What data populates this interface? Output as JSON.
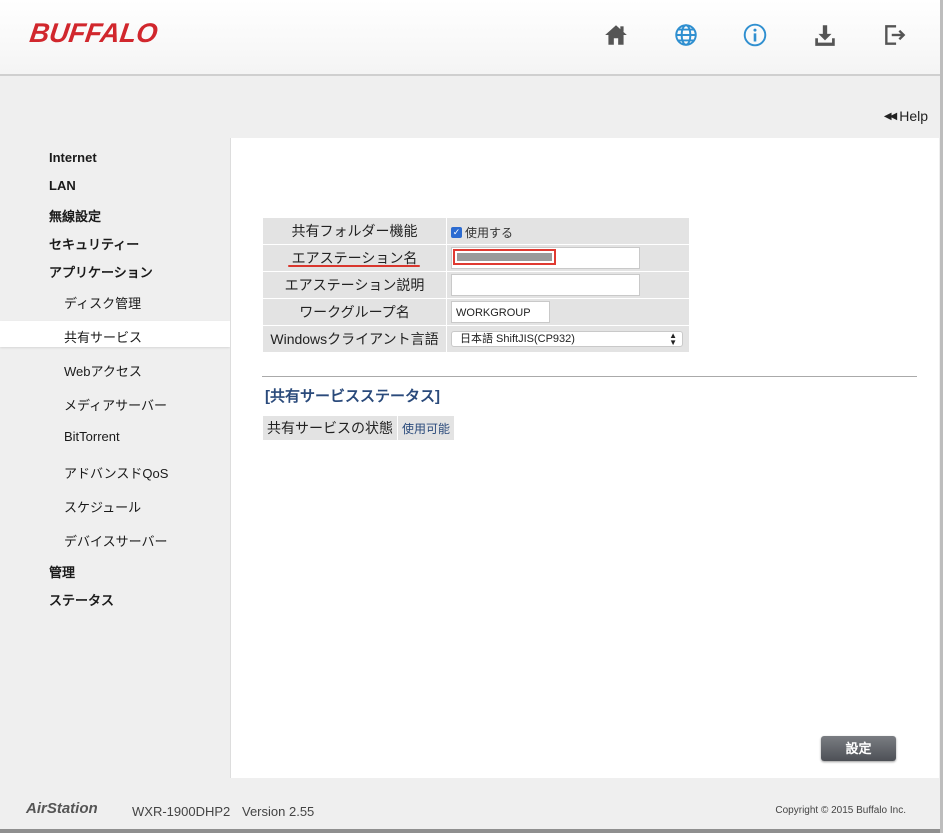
{
  "header": {
    "logo": "BUFFALO",
    "icons": [
      {
        "name": "home-icon",
        "color": "#555555"
      },
      {
        "name": "globe-icon",
        "color": "#2f8fd0"
      },
      {
        "name": "info-icon",
        "color": "#2f8fd0"
      },
      {
        "name": "download-icon",
        "color": "#555555"
      },
      {
        "name": "logout-icon",
        "color": "#555555"
      }
    ]
  },
  "help": {
    "label": "Help",
    "arrow": "◀◀"
  },
  "sidebar": {
    "items": [
      {
        "label": "Internet",
        "level": 1
      },
      {
        "label": "LAN",
        "level": 1
      },
      {
        "label": "無線設定",
        "level": 1
      },
      {
        "label": "セキュリティー",
        "level": 1
      },
      {
        "label": "アプリケーション",
        "level": 1
      },
      {
        "label": "ディスク管理",
        "level": 2
      },
      {
        "label": "共有サービス",
        "level": 2,
        "active": true
      },
      {
        "label": "Webアクセス",
        "level": 2
      },
      {
        "label": "メディアサーバー",
        "level": 2
      },
      {
        "label": "BitTorrent",
        "level": 2
      },
      {
        "label": "アドバンスドQoS",
        "level": 2
      },
      {
        "label": "スケジュール",
        "level": 2
      },
      {
        "label": "デバイスサーバー",
        "level": 2
      },
      {
        "label": "管理",
        "level": 1
      },
      {
        "label": "ステータス",
        "level": 1
      }
    ]
  },
  "form": {
    "shared_folder": {
      "label": "共有フォルダー機能",
      "checkbox_label": "使用する",
      "checked": true
    },
    "airstation_name": {
      "label": "エアステーション名",
      "value": ""
    },
    "airstation_desc": {
      "label": "エアステーション説明",
      "value": ""
    },
    "workgroup": {
      "label": "ワークグループ名",
      "value": "WORKGROUP"
    },
    "windows_lang": {
      "label": "Windowsクライアント言語",
      "value": "日本語 ShiftJIS(CP932)"
    }
  },
  "status": {
    "title": "[共有サービスステータス]",
    "label": "共有サービスの状態",
    "value": "使用可能"
  },
  "buttons": {
    "set": "設定"
  },
  "footer": {
    "brand": "AirStation",
    "model": "WXR-1900DHP2",
    "version": "Version 2.55",
    "copyright": "Copyright © 2015 Buffalo Inc."
  },
  "colors": {
    "brand_red": "#d1272d",
    "accent_blue": "#2f8fd0",
    "status_blue": "#2a4a7b",
    "highlight_red": "#e03a31"
  }
}
